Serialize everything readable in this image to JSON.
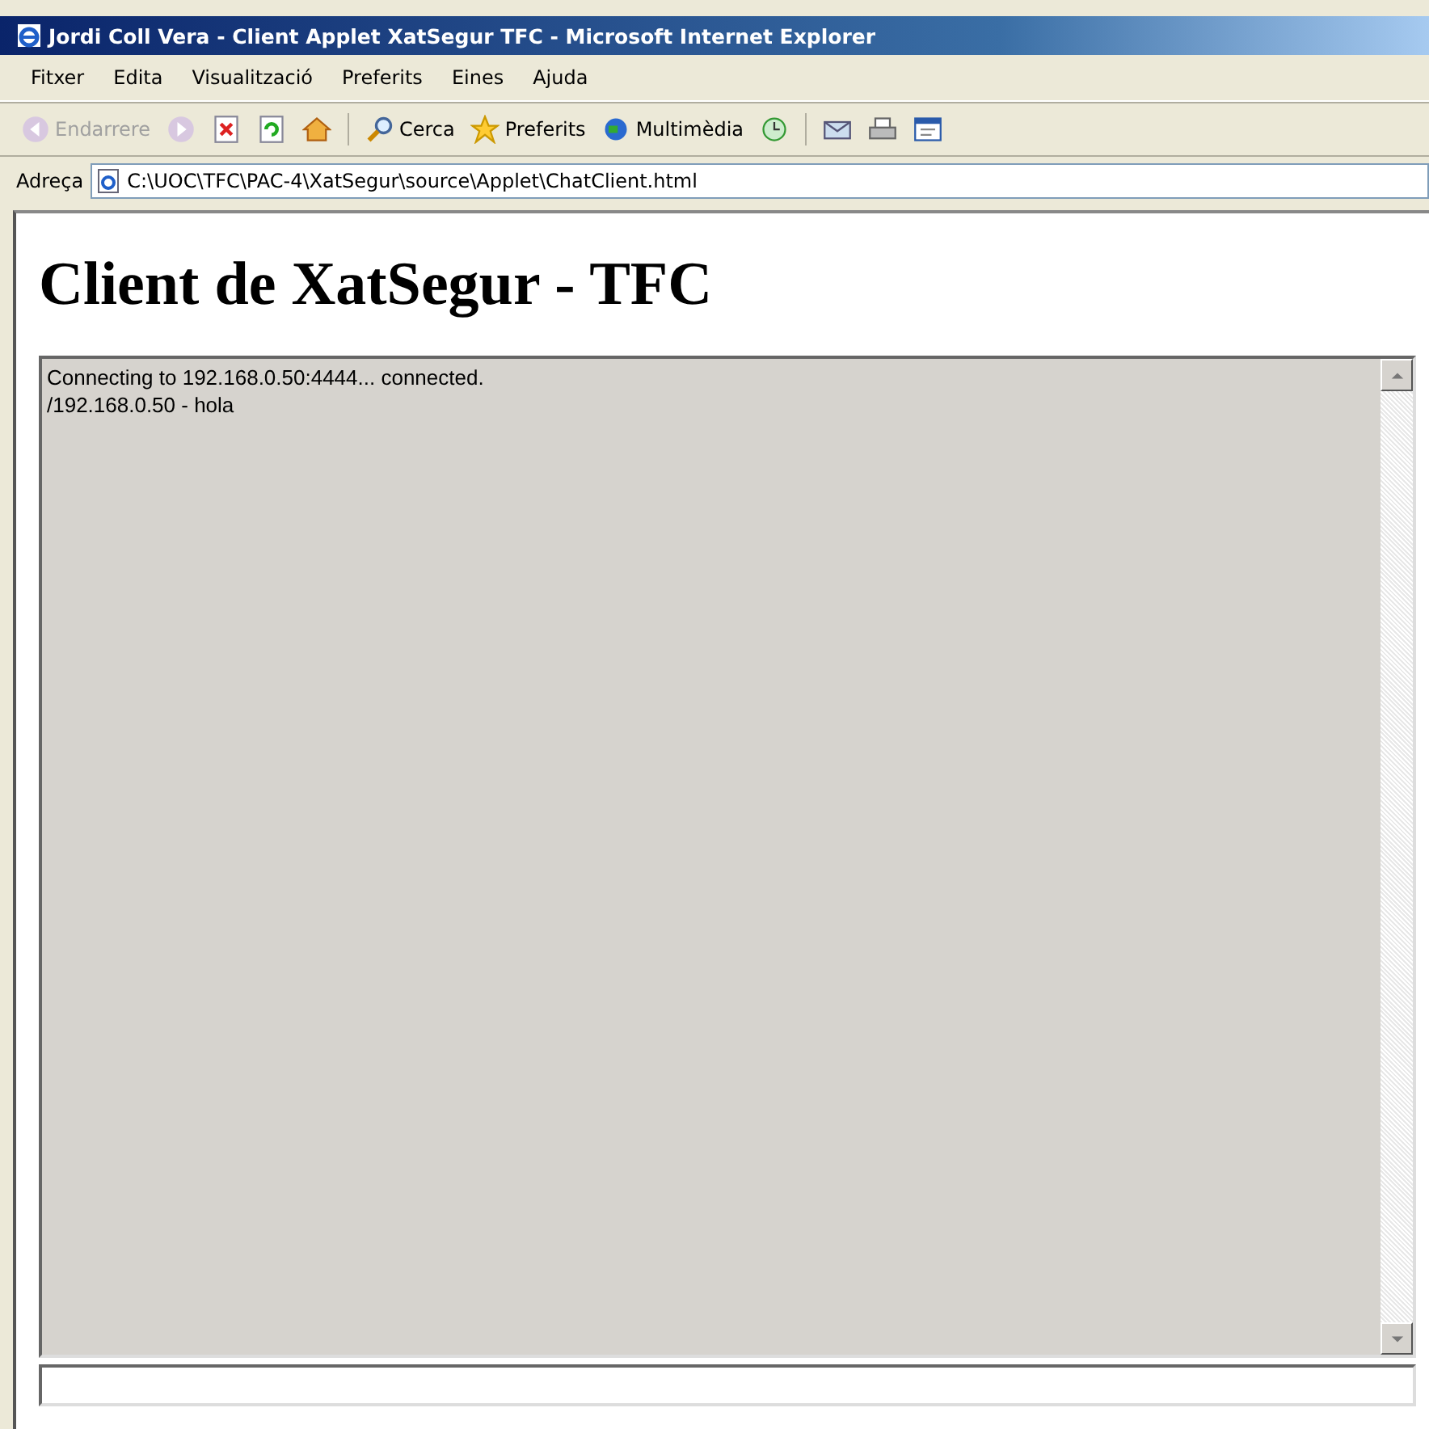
{
  "window": {
    "title": "Jordi Coll Vera - Client Applet XatSegur TFC - Microsoft Internet Explorer"
  },
  "menu": [
    "Fitxer",
    "Edita",
    "Visualització",
    "Preferits",
    "Eines",
    "Ajuda"
  ],
  "toolbar": [
    {
      "kind": "back",
      "label": "Endarrere",
      "disabled": true
    },
    {
      "kind": "forward",
      "disabled": true
    },
    {
      "kind": "stop"
    },
    {
      "kind": "refresh"
    },
    {
      "kind": "home"
    },
    {
      "kind": "sep"
    },
    {
      "kind": "search",
      "label": "Cerca"
    },
    {
      "kind": "favorites",
      "label": "Preferits"
    },
    {
      "kind": "media",
      "label": "Multimèdia"
    },
    {
      "kind": "history"
    },
    {
      "kind": "sep"
    },
    {
      "kind": "mail"
    },
    {
      "kind": "print"
    },
    {
      "kind": "edit"
    }
  ],
  "address": {
    "label": "Adreça",
    "value": "C:\\UOC\\TFC\\PAC-4\\XatSegur\\source\\Applet\\ChatClient.html"
  },
  "page": {
    "heading": "Client de XatSegur - TFC",
    "chat_lines": [
      "Connecting to 192.168.0.50:4444... connected.",
      "/192.168.0.50 - hola"
    ]
  }
}
